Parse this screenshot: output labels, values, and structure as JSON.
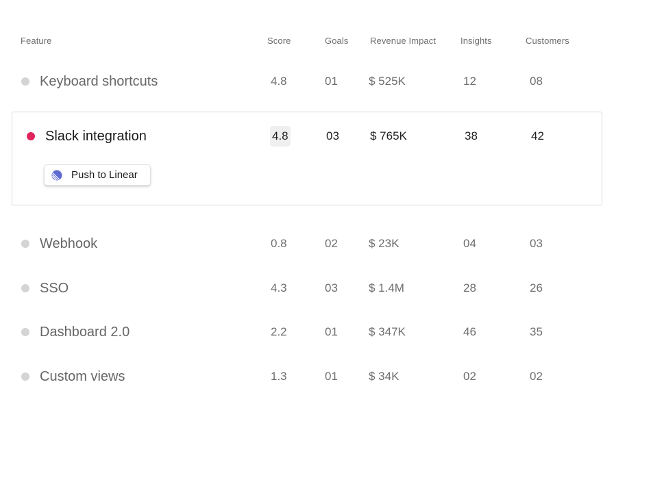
{
  "columns": {
    "feature": "Feature",
    "score": "Score",
    "goals": "Goals",
    "revenue": "Revenue Impact",
    "insights": "Insights",
    "customers": "Customers"
  },
  "rows": [
    {
      "feature": "Keyboard shortcuts",
      "score": "4.8",
      "goals": "01",
      "revenue": "$ 525K",
      "insights": "12",
      "customers": "08",
      "status_color": "#d4d4d4"
    },
    {
      "feature": "Slack integration",
      "score": "4.8",
      "goals": "03",
      "revenue": "$ 765K",
      "insights": "38",
      "customers": "42",
      "status_color": "#e0245e",
      "selected": true
    },
    {
      "feature": "Webhook",
      "score": "0.8",
      "goals": "02",
      "revenue": "$ 23K",
      "insights": "04",
      "customers": "03",
      "status_color": "#d4d4d4"
    },
    {
      "feature": "SSO",
      "score": "4.3",
      "goals": "03",
      "revenue": "$ 1.4M",
      "insights": "28",
      "customers": "26",
      "status_color": "#d4d4d4"
    },
    {
      "feature": "Dashboard 2.0",
      "score": "2.2",
      "goals": "01",
      "revenue": "$ 347K",
      "insights": "46",
      "customers": "35",
      "status_color": "#d4d4d4"
    },
    {
      "feature": "Custom views",
      "score": "1.3",
      "goals": "01",
      "revenue": "$ 34K",
      "insights": "02",
      "customers": "02",
      "status_color": "#d4d4d4"
    }
  ],
  "action": {
    "push_label": "Push to Linear",
    "icon": "linear-icon"
  },
  "colors": {
    "accent": "#e0245e",
    "linear_brand": "#5e6ad2"
  }
}
